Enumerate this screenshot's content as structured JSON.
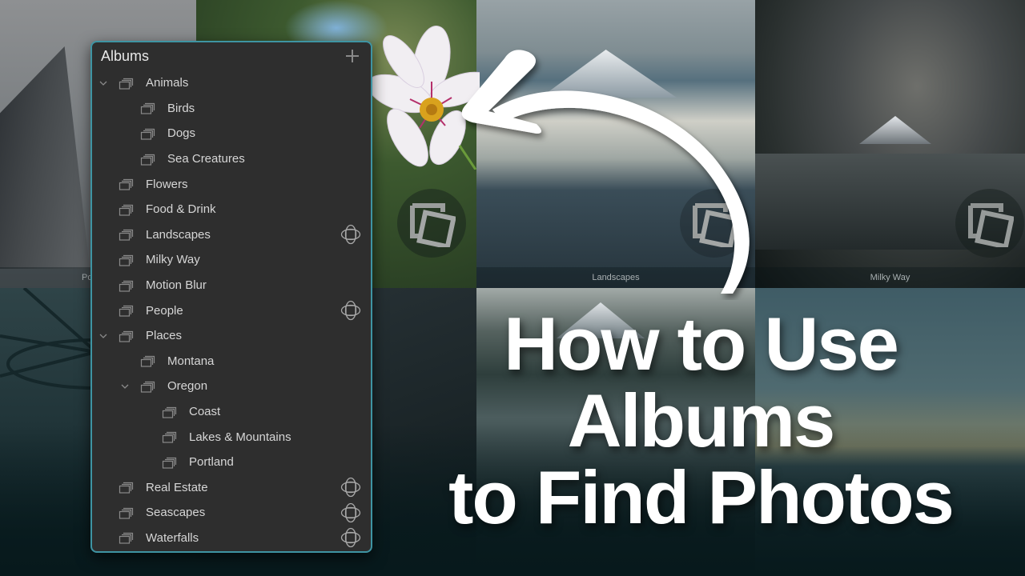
{
  "panel": {
    "title": "Albums",
    "add_icon": "plus-icon",
    "accent_color": "#3e94a3",
    "albums": [
      {
        "label": "Animals",
        "level": 0,
        "expanded": true,
        "shared": false
      },
      {
        "label": "Birds",
        "level": 1,
        "shared": false
      },
      {
        "label": "Dogs",
        "level": 1,
        "shared": false
      },
      {
        "label": "Sea Creatures",
        "level": 1,
        "shared": false
      },
      {
        "label": "Flowers",
        "level": 0,
        "shared": false
      },
      {
        "label": "Food & Drink",
        "level": 0,
        "shared": false
      },
      {
        "label": "Landscapes",
        "level": 0,
        "shared": true
      },
      {
        "label": "Milky Way",
        "level": 0,
        "shared": false
      },
      {
        "label": "Motion Blur",
        "level": 0,
        "shared": false
      },
      {
        "label": "People",
        "level": 0,
        "shared": true
      },
      {
        "label": "Places",
        "level": 0,
        "expanded": true,
        "shared": false
      },
      {
        "label": "Montana",
        "level": 1,
        "shared": false
      },
      {
        "label": "Oregon",
        "level": 1,
        "expanded": true,
        "shared": false
      },
      {
        "label": "Coast",
        "level": 2,
        "shared": false
      },
      {
        "label": "Lakes & Mountains",
        "level": 2,
        "shared": false
      },
      {
        "label": "Portland",
        "level": 2,
        "shared": false
      },
      {
        "label": "Real Estate",
        "level": 0,
        "shared": true
      },
      {
        "label": "Seascapes",
        "level": 0,
        "shared": true
      },
      {
        "label": "Waterfalls",
        "level": 0,
        "shared": true
      }
    ]
  },
  "photos": {
    "tiles": [
      {
        "caption": "Portland"
      },
      {
        "caption": ""
      },
      {
        "caption": "Landscapes"
      },
      {
        "caption": "Milky Way"
      }
    ]
  },
  "headline": {
    "lines": [
      "How to Use",
      "Albums",
      "to Find Photos"
    ]
  }
}
